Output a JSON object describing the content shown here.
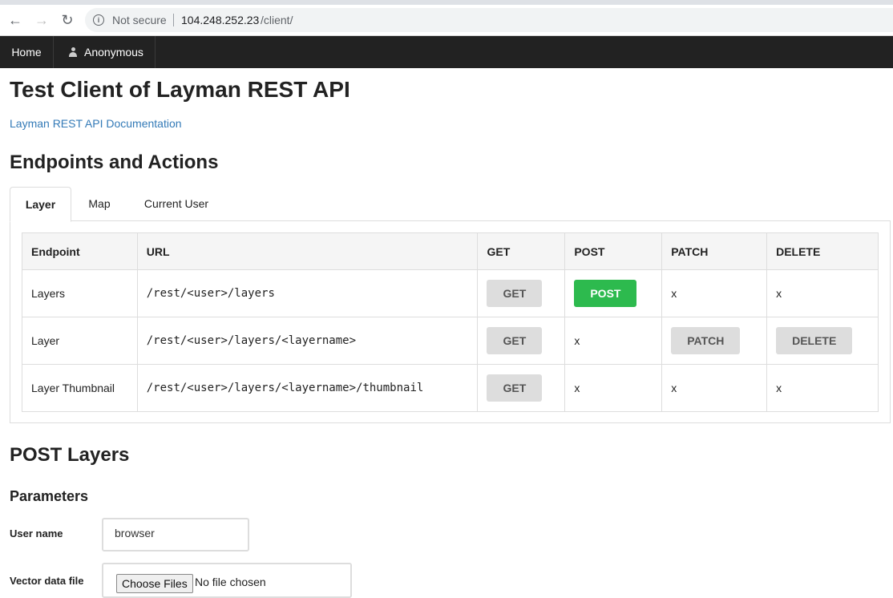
{
  "browser": {
    "not_secure": "Not secure",
    "url_host": "104.248.252.23",
    "url_path": "/client/",
    "back_icon": "←",
    "forward_icon": "→",
    "reload_icon": "↻"
  },
  "navbar": {
    "home": "Home",
    "user": "Anonymous"
  },
  "page": {
    "title": "Test Client of Layman REST API",
    "doc_link": "Layman REST API Documentation",
    "section_title": "Endpoints and Actions"
  },
  "tabs": [
    {
      "label": "Layer",
      "active": true
    },
    {
      "label": "Map",
      "active": false
    },
    {
      "label": "Current User",
      "active": false
    }
  ],
  "table": {
    "headers": [
      "Endpoint",
      "URL",
      "GET",
      "POST",
      "PATCH",
      "DELETE"
    ],
    "rows": [
      {
        "endpoint": "Layers",
        "url": "/rest/<user>/layers",
        "get": "GET",
        "post": "POST",
        "patch": "x",
        "delete": "x"
      },
      {
        "endpoint": "Layer",
        "url": "/rest/<user>/layers/<layername>",
        "get": "GET",
        "post": "x",
        "patch": "PATCH",
        "delete": "DELETE"
      },
      {
        "endpoint": "Layer Thumbnail",
        "url": "/rest/<user>/layers/<layername>/thumbnail",
        "get": "GET",
        "post": "x",
        "patch": "x",
        "delete": "x"
      }
    ]
  },
  "form": {
    "title": "POST Layers",
    "params_title": "Parameters",
    "user_name_label": "User name",
    "user_name_value": "browser",
    "vector_file_label": "Vector data file",
    "choose_files": "Choose Files",
    "no_file": "No file chosen"
  },
  "colors": {
    "navbar_bg": "#222222",
    "link": "#337ab7",
    "success": "#2dba4e"
  }
}
